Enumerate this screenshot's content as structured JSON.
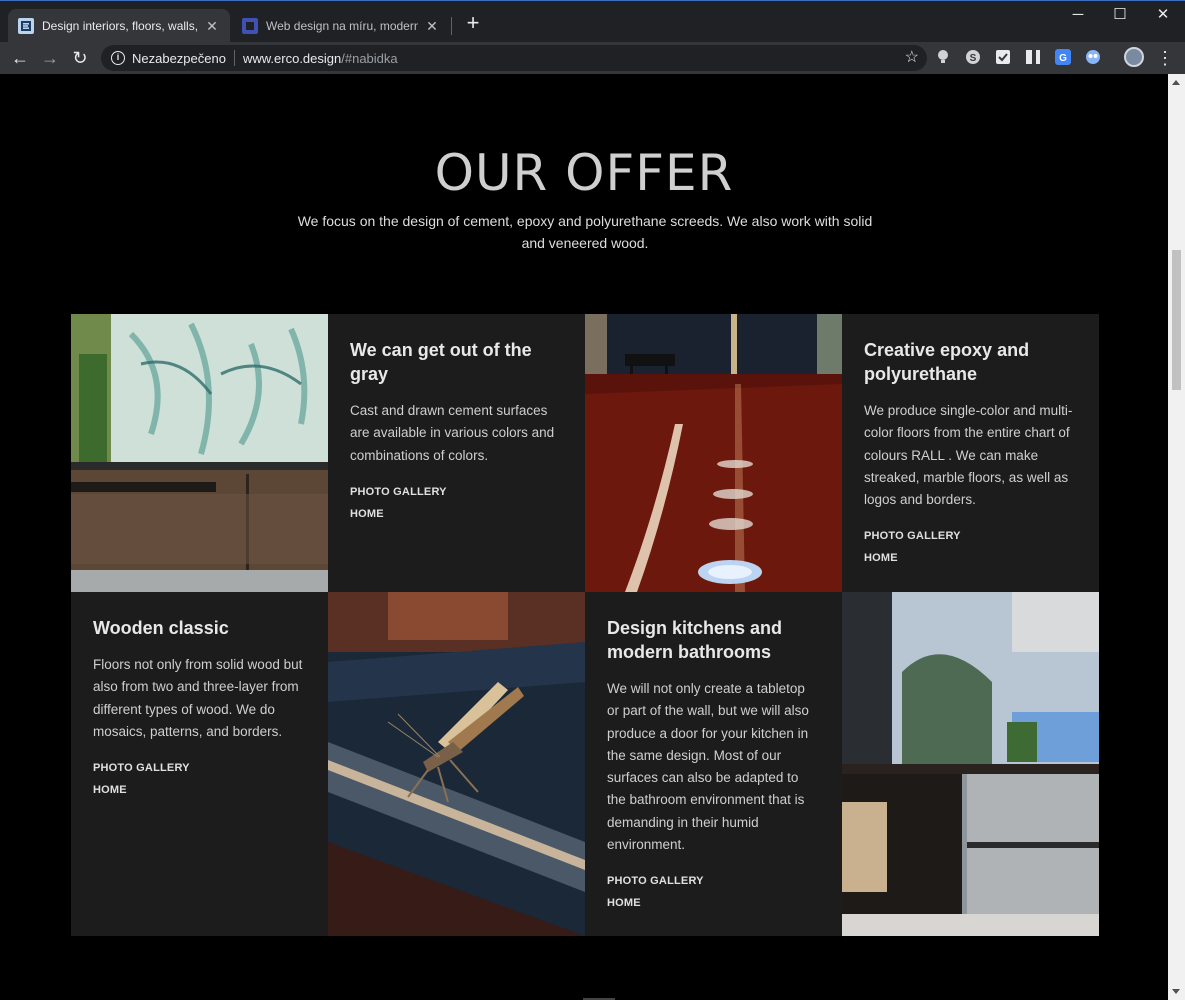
{
  "browser": {
    "tabs": [
      {
        "title": "Design interiors, floors, walls, kitc",
        "active": true,
        "favicon_color": "#b9d3f0"
      },
      {
        "title": "Web design na míru, moderní, re",
        "active": false,
        "favicon_color": "#3f51b5"
      }
    ],
    "address": {
      "security_label": "Nezabezpečeno",
      "host": "www.erco.design",
      "path": "/#nabidka"
    },
    "icons": {
      "back": "back-arrow-icon",
      "forward": "forward-arrow-icon",
      "reload": "reload-icon",
      "bookmark": "star-icon",
      "menu": "kebab-menu-icon"
    },
    "glyphs": {
      "close": "✕",
      "new_tab": "+",
      "minimize": "─",
      "maximize": "☐",
      "window_close": "✕",
      "back": "←",
      "forward": "→",
      "reload": "↻",
      "info": "i",
      "star": "☆",
      "menu": "⋮"
    }
  },
  "page": {
    "title": "OUR OFFER",
    "subtitle": "We focus on the design of cement, epoxy and polyurethane screeds. We also work with solid and veneered wood.",
    "cards": [
      {
        "title": "We can get out of the gray",
        "body": "Cast and drawn cement surfaces are available in various colors and combinations of colors.",
        "link_gallery": "PHOTO GALLERY",
        "link_home": "HOME"
      },
      {
        "title": "Creative epoxy and polyurethane",
        "body": "We produce single-color and multi-color floors from the entire chart of colours RALL . We can make streaked, marble floors, as well as logos and borders.",
        "link_gallery": "PHOTO GALLERY",
        "link_home": "HOME"
      },
      {
        "title": "Wooden classic",
        "body": "Floors not only from solid wood but also from two and three-layer from different types of wood. We do mosaics, patterns, and borders.",
        "link_gallery": "PHOTO GALLERY",
        "link_home": "HOME"
      },
      {
        "title": "Design kitchens and modern bathrooms",
        "body": "We will not only create a tabletop or part of the wall, but we will also produce a door for your kitchen in the same design. Most of our surfaces can also be adapted to the bathroom environment that is demanding in their humid environment.",
        "link_gallery": "PHOTO GALLERY",
        "link_home": "HOME"
      }
    ]
  },
  "colors": {
    "page_bg": "#000000",
    "card_bg": "#1c1c1c",
    "title_text": "#cfcfcf",
    "chrome_dark": "#202124",
    "chrome_toolbar": "#35363a"
  }
}
